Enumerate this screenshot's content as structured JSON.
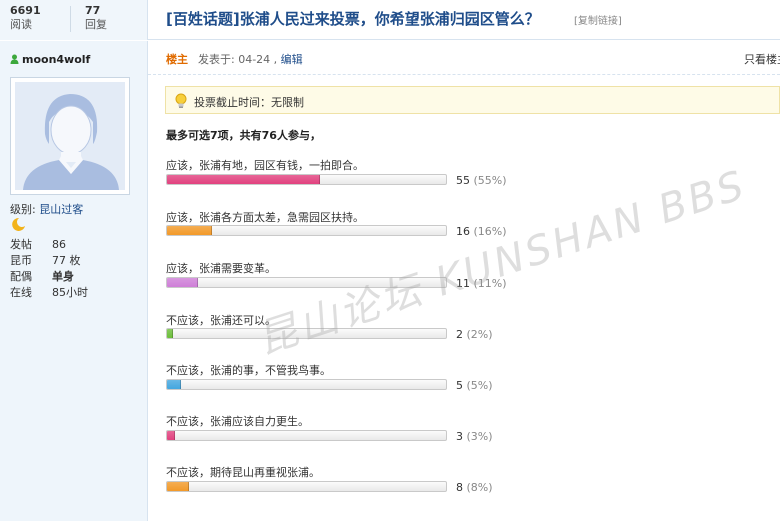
{
  "stats": {
    "views_num": "6691",
    "views_label": "阅读",
    "replies_num": "77",
    "replies_label": "回复"
  },
  "thread": {
    "title": "[百姓话题]张浦人民过来投票，你希望张浦归园区管么？",
    "copy_link": "[复制链接]"
  },
  "author": {
    "username": "moon4wolf",
    "level_label": "级别:",
    "level_value": "昆山过客",
    "info": [
      {
        "key": "发帖",
        "value": "86"
      },
      {
        "key": "昆币",
        "value": "77 枚"
      },
      {
        "key": "配偶",
        "value": "单身"
      },
      {
        "key": "在线",
        "value": "85小时"
      }
    ]
  },
  "post": {
    "floor": "楼主",
    "posted_prefix": "发表于: 04-24 ,",
    "edit": "编辑",
    "only_author": "只看楼主"
  },
  "poll": {
    "deadline_text": "投票截止时间：无限制",
    "summary": "最多可选7项，共有76人参与，",
    "options": [
      {
        "label": "应该，张浦有地，园区有钱，一拍即合。",
        "count": "55",
        "pct": "(55%)",
        "fraction": 0.55,
        "color": "#e2427f"
      },
      {
        "label": "应该，张浦各方面太差，急需园区扶持。",
        "count": "16",
        "pct": "(16%)",
        "fraction": 0.16,
        "color": "#f39a2a"
      },
      {
        "label": "应该，张浦需要变革。",
        "count": "11",
        "pct": "(11%)",
        "fraction": 0.11,
        "color": "#cf7fd8"
      },
      {
        "label": "不应该，张浦还可以。",
        "count": "2",
        "pct": "(2%)",
        "fraction": 0.02,
        "color": "#6cbf3a"
      },
      {
        "label": "不应该，张浦的事，不管我鸟事。",
        "count": "5",
        "pct": "(5%)",
        "fraction": 0.05,
        "color": "#44a7e0"
      },
      {
        "label": "不应该，张浦应该自力更生。",
        "count": "3",
        "pct": "(3%)",
        "fraction": 0.03,
        "color": "#e2427f"
      },
      {
        "label": "不应该，期待昆山再重视张浦。",
        "count": "8",
        "pct": "(8%)",
        "fraction": 0.08,
        "color": "#f39a2a"
      }
    ]
  },
  "watermark": "昆山论坛 KUNSHAN BBS"
}
